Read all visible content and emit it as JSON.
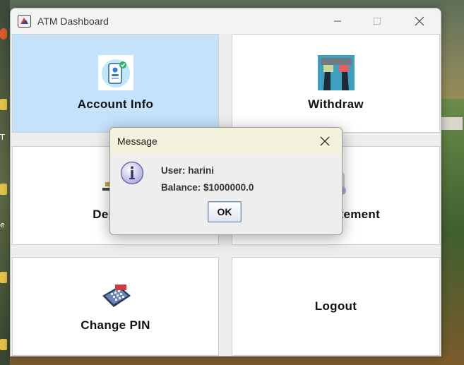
{
  "window": {
    "title": "ATM Dashboard",
    "controls": [
      "minimize-icon",
      "maximize-icon",
      "close-icon"
    ]
  },
  "tiles": [
    {
      "label": "Account Info",
      "icon": "account-info-icon",
      "active": true
    },
    {
      "label": "Withdraw",
      "icon": "withdraw-icon",
      "active": false
    },
    {
      "label": "Deposit",
      "icon": "deposit-icon",
      "active": false
    },
    {
      "label": "Mini Statement",
      "icon": "statement-icon",
      "active": false
    },
    {
      "label": "Change PIN",
      "icon": "change-pin-icon",
      "active": false
    },
    {
      "label": "Logout",
      "icon": "",
      "active": false
    }
  ],
  "dialog": {
    "title": "Message",
    "icon": "info-icon",
    "line1": "User: harini",
    "line2": "Balance: $1000000.0",
    "ok_label": "OK"
  },
  "desktop": {
    "left_text_1": "T",
    "left_text_2": "e"
  },
  "colors": {
    "active_tile": "#c5e2fb",
    "dialog_title": "#f4f1dc"
  }
}
